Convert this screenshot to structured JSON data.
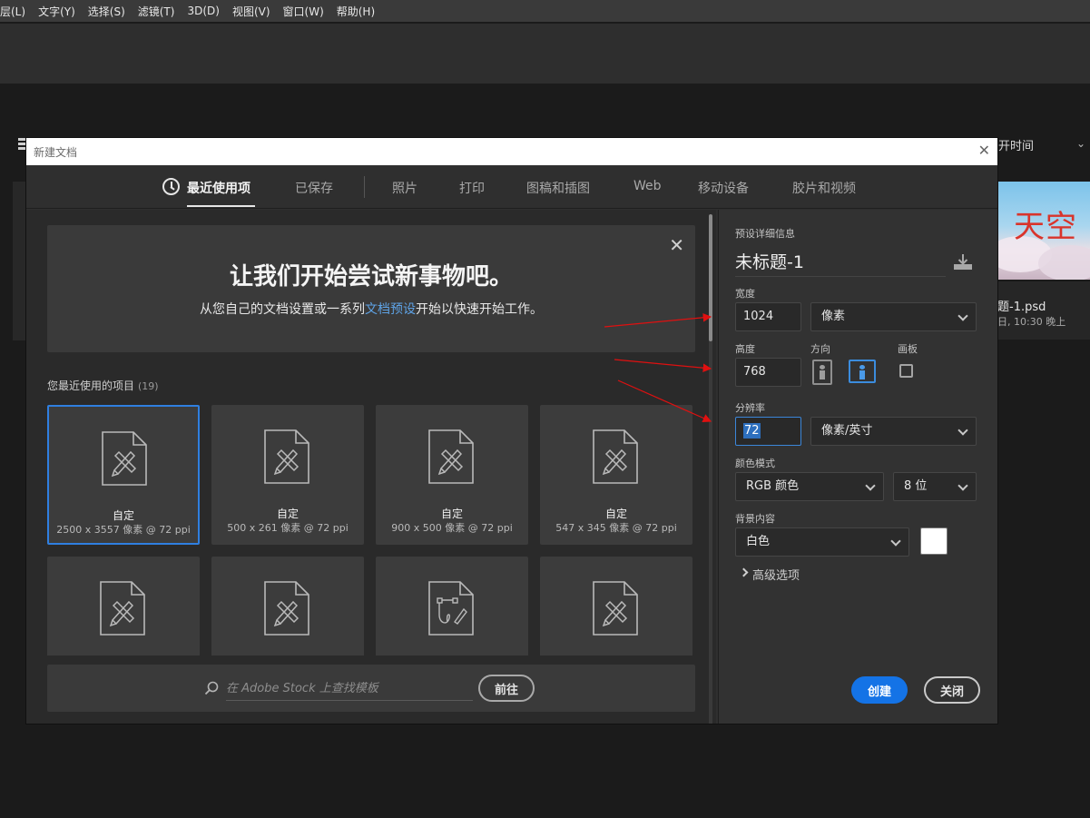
{
  "menubar": {
    "items": [
      "层(L)",
      "文字(Y)",
      "选择(S)",
      "滤镜(T)",
      "3D(D)",
      "视图(V)",
      "窗口(W)",
      "帮助(H)"
    ]
  },
  "background": {
    "sort_label": "开时间",
    "file_name": "题-1.psd",
    "file_date": "日, 10:30 晚上",
    "thumb_text": "天空"
  },
  "dialog": {
    "title": "新建文档",
    "tabs": [
      {
        "label": "最近使用项",
        "active": true
      },
      {
        "label": "已保存"
      },
      {
        "label": "照片"
      },
      {
        "label": "打印"
      },
      {
        "label": "图稿和插图"
      },
      {
        "label": "Web"
      },
      {
        "label": "移动设备"
      },
      {
        "label": "胶片和视频"
      }
    ],
    "welcome": {
      "heading": "让我们开始尝试新事物吧。",
      "sub_pre": "从您自己的文档设置或一系列",
      "sub_link": "文档预设",
      "sub_post": "开始以快速开始工作。"
    },
    "recent": {
      "label": "您最近使用的项目",
      "count": "(19)",
      "items": [
        {
          "name": "自定",
          "dims": "2500 x 3557 像素 @ 72 ppi"
        },
        {
          "name": "自定",
          "dims": "500 x 261 像素 @ 72 ppi"
        },
        {
          "name": "自定",
          "dims": "900 x 500 像素 @ 72 ppi"
        },
        {
          "name": "自定",
          "dims": "547 x 345 像素 @ 72 ppi"
        }
      ]
    },
    "stock": {
      "placeholder": "在 Adobe Stock 上查找模板",
      "go_label": "前往"
    },
    "preset": {
      "section_label": "预设详细信息",
      "doc_name": "未标题-1",
      "width_label": "宽度",
      "width_value": "1024",
      "width_unit": "像素",
      "height_label": "高度",
      "height_value": "768",
      "orientation_label": "方向",
      "artboard_label": "画板",
      "resolution_label": "分辨率",
      "resolution_value": "72",
      "resolution_unit": "像素/英寸",
      "color_mode_label": "颜色模式",
      "color_mode": "RGB 颜色",
      "bit_depth": "8 位",
      "background_label": "背景内容",
      "background": "白色",
      "background_color": "#ffffff",
      "advanced_label": "高级选项"
    },
    "buttons": {
      "create": "创建",
      "close": "关闭"
    }
  },
  "colors": {
    "accent": "#1473e6",
    "focus": "#3b86d9",
    "annotation_arrow": "#e01010"
  }
}
